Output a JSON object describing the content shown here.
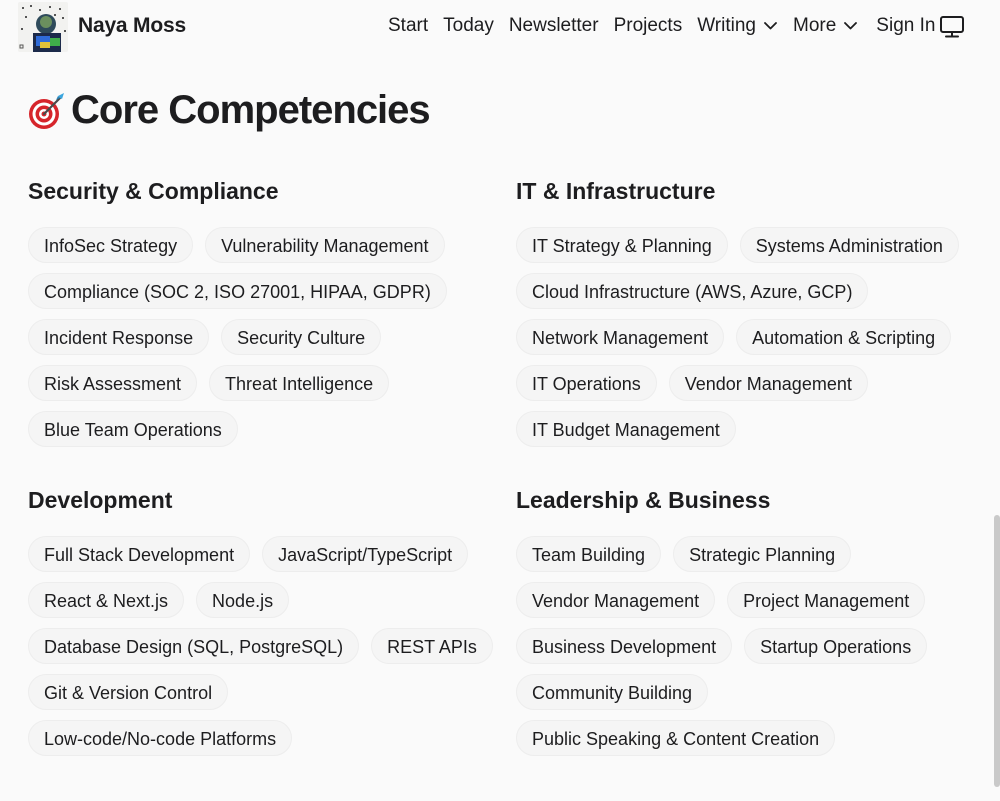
{
  "header": {
    "site_name": "Naya Moss",
    "nav": [
      {
        "label": "Start",
        "dropdown": false
      },
      {
        "label": "Today",
        "dropdown": false
      },
      {
        "label": "Newsletter",
        "dropdown": false
      },
      {
        "label": "Projects",
        "dropdown": false
      },
      {
        "label": "Writing",
        "dropdown": true
      },
      {
        "label": "More",
        "dropdown": true
      },
      {
        "label": "Sign In",
        "dropdown": false
      }
    ],
    "theme_icon": "monitor-icon"
  },
  "main": {
    "title": "Core Competencies",
    "title_icon": "direct-hit-icon",
    "sections": [
      {
        "heading": "Security & Compliance",
        "items": [
          "InfoSec Strategy",
          "Vulnerability Management",
          "Compliance (SOC 2, ISO 27001, HIPAA, GDPR)",
          "Incident Response",
          "Security Culture",
          "Risk Assessment",
          "Threat Intelligence",
          "Blue Team Operations"
        ]
      },
      {
        "heading": "IT & Infrastructure",
        "items": [
          "IT Strategy & Planning",
          "Systems Administration",
          "Cloud Infrastructure (AWS, Azure, GCP)",
          "Network Management",
          "Automation & Scripting",
          "IT Operations",
          "Vendor Management",
          "IT Budget Management"
        ]
      },
      {
        "heading": "Development",
        "items": [
          "Full Stack Development",
          "JavaScript/TypeScript",
          "React & Next.js",
          "Node.js",
          "Database Design (SQL, PostgreSQL)",
          "REST APIs",
          "Git & Version Control",
          "Low-code/No-code Platforms"
        ]
      },
      {
        "heading": "Leadership & Business",
        "items": [
          "Team Building",
          "Strategic Planning",
          "Vendor Management",
          "Project Management",
          "Business Development",
          "Startup Operations",
          "Community Building",
          "Public Speaking & Content Creation"
        ]
      }
    ]
  },
  "colors": {
    "background": "#fafafa",
    "text": "#1d1d1f",
    "chip_background": "#f5f5f5",
    "chip_border": "#ededed"
  }
}
